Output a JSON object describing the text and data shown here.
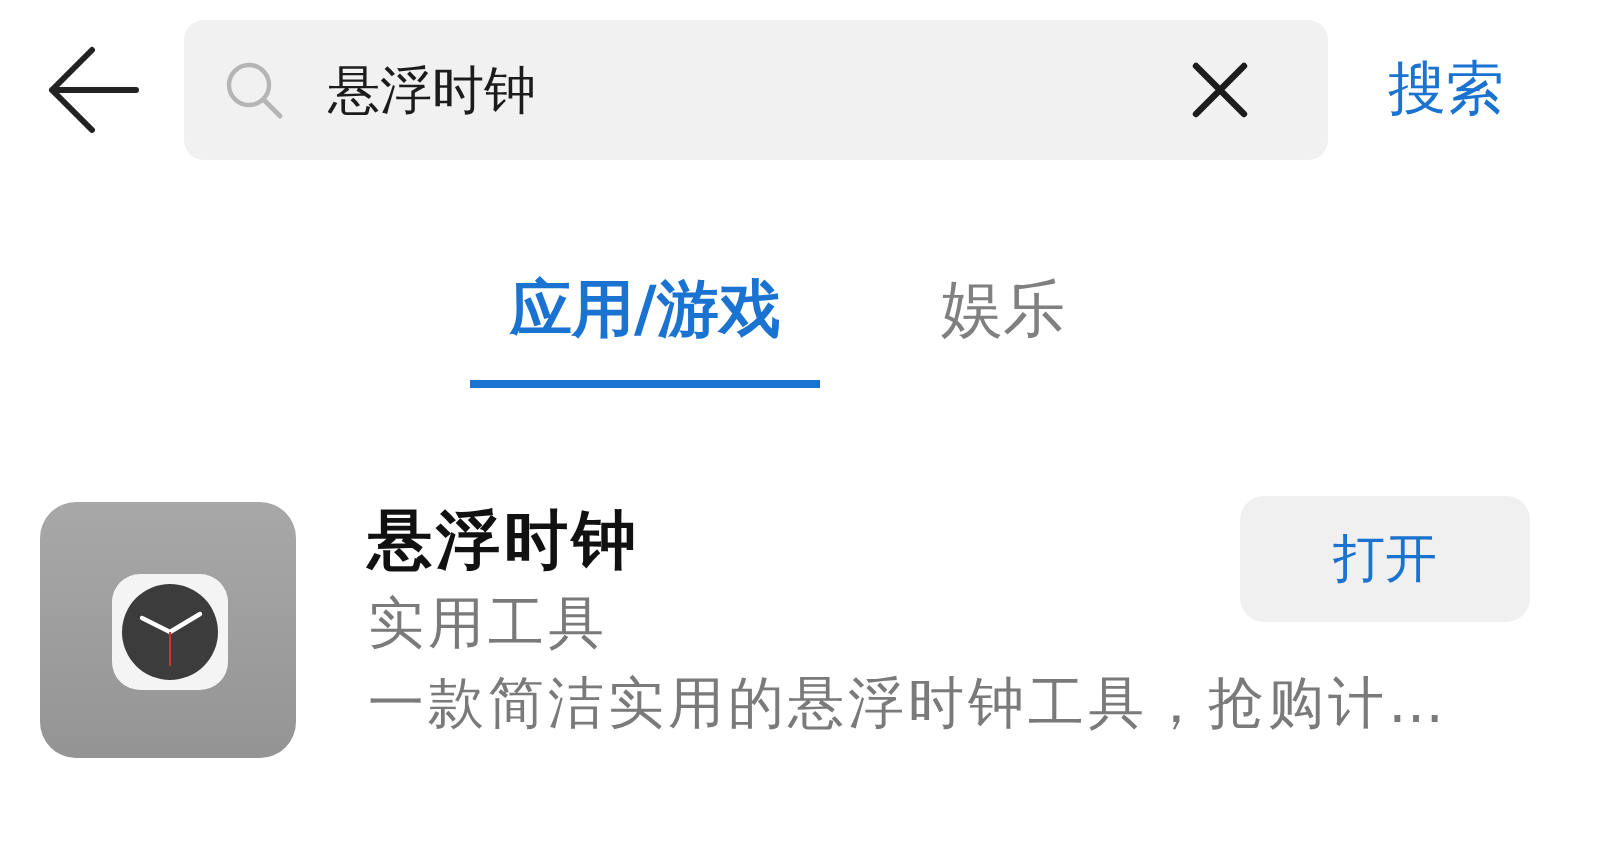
{
  "search": {
    "value": "悬浮时钟",
    "submit": "搜索"
  },
  "tabs": [
    {
      "label": "应用/游戏",
      "selected": true
    },
    {
      "label": "娱乐",
      "selected": false
    }
  ],
  "results": [
    {
      "name": "悬浮时钟",
      "category": "实用工具",
      "description": "一款简洁实用的悬浮时钟工具，抢购计…",
      "action": "打开"
    }
  ]
}
